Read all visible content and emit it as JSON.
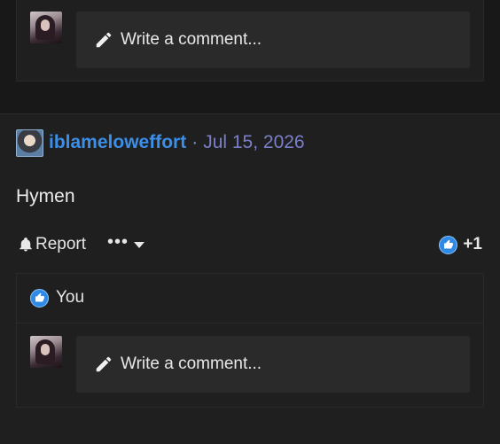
{
  "top_reply": {
    "comment_placeholder": "Write a comment..."
  },
  "post": {
    "username": "iblameloweffort",
    "separator": "·",
    "date": "Jul 15, 2026",
    "body": "Hymen",
    "report_label": "Report",
    "more_label": "•••",
    "reaction_count": "+1",
    "likes_label": "You",
    "comment_placeholder": "Write a comment..."
  },
  "colors": {
    "username": "#3b8fe8",
    "date": "#7a7fc9",
    "like_badge": "#2f8ae6"
  }
}
